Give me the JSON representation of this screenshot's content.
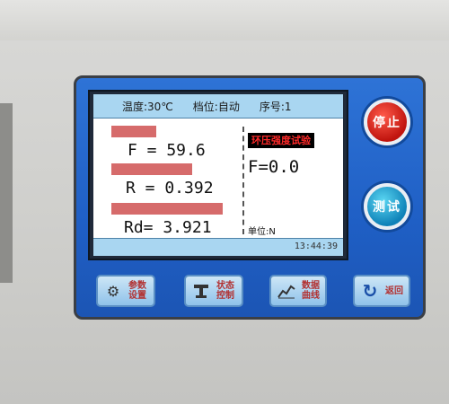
{
  "screen": {
    "header": {
      "temperature": "温度:30℃",
      "gear": "档位:自动",
      "sequence": "序号:1"
    },
    "readings": [
      {
        "label": "",
        "value": "F = 59.6"
      },
      {
        "label": "",
        "value": "R = 0.392"
      },
      {
        "label": "",
        "value": "Rd= 3.921"
      }
    ],
    "test_title": "环压强度试验",
    "force_value": "F=0.0",
    "unit": "单位:N",
    "time": "13:44:39"
  },
  "buttons": {
    "stop": "停止",
    "test": "测试"
  },
  "softkeys": [
    {
      "line1": "参数",
      "line2": "设置",
      "icon": "gear-icon"
    },
    {
      "line1": "状态",
      "line2": "控制",
      "icon": "control-icon"
    },
    {
      "line1": "数据",
      "line2": "曲线",
      "icon": "chart-icon"
    },
    {
      "line1": "返回",
      "line2": "",
      "icon": "return-icon"
    }
  ],
  "colors": {
    "panel": "#1f5fc5",
    "screen_bar": "#a9d6f1",
    "label_bg": "#d66b6b",
    "stop_button": "#c0140e",
    "test_button": "#0f82b8"
  }
}
